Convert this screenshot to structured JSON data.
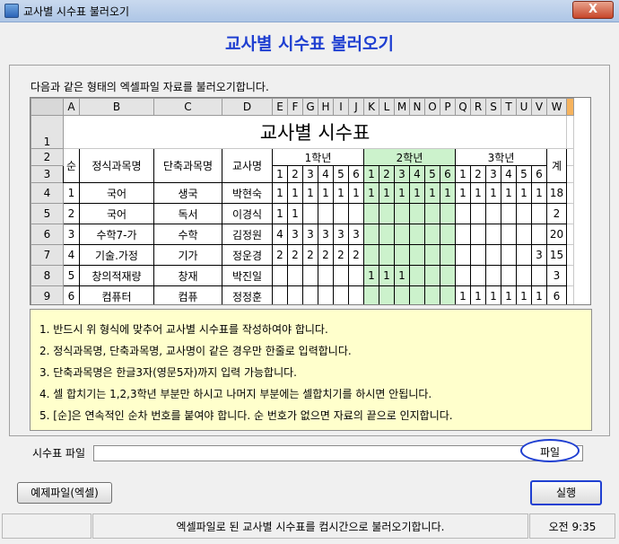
{
  "window": {
    "title": "교사별 시수표 불러오기",
    "close_label": "X"
  },
  "heading": "교사별 시수표 불러오기",
  "intro": "다음과 같은 형태의 엑셀파일 자료를 불러오기합니다.",
  "sheet": {
    "columns": [
      "A",
      "B",
      "C",
      "D",
      "E",
      "F",
      "G",
      "H",
      "I",
      "J",
      "K",
      "L",
      "M",
      "N",
      "O",
      "P",
      "Q",
      "R",
      "S",
      "T",
      "U",
      "V",
      "W"
    ],
    "row_numbers": [
      "1",
      "2",
      "3",
      "4",
      "5",
      "6",
      "7",
      "8",
      "9"
    ],
    "title": "교사별 시수표",
    "headers": {
      "no": "순",
      "full_name": "정식과목명",
      "short_name": "단축과목명",
      "teacher": "교사명",
      "total": "계"
    },
    "grades": [
      "1학년",
      "2학년",
      "3학년"
    ],
    "periods": [
      "1",
      "2",
      "3",
      "4",
      "5",
      "6"
    ],
    "rows": [
      {
        "no": "1",
        "full": "국어",
        "short": "생국",
        "teacher": "박현숙",
        "g": [
          "1",
          "1",
          "1",
          "1",
          "1",
          "1",
          "1",
          "1",
          "1",
          "1",
          "1",
          "1",
          "1",
          "1",
          "1",
          "1",
          "1",
          "1"
        ],
        "total": "18"
      },
      {
        "no": "2",
        "full": "국어",
        "short": "독서",
        "teacher": "이경식",
        "g": [
          "1",
          "1",
          "",
          "",
          "",
          "",
          "",
          "",
          "",
          "",
          "",
          "",
          "",
          "",
          "",
          "",
          "",
          ""
        ],
        "total": "2"
      },
      {
        "no": "3",
        "full": "수학7-가",
        "short": "수학",
        "teacher": "김정원",
        "g": [
          "4",
          "3",
          "3",
          "3",
          "3",
          "3",
          "",
          "",
          "",
          "",
          "",
          "",
          "",
          "",
          "",
          "",
          "",
          ""
        ],
        "total": "20"
      },
      {
        "no": "4",
        "full": "기술.가정",
        "short": "기가",
        "teacher": "정운경",
        "g": [
          "2",
          "2",
          "2",
          "2",
          "2",
          "2",
          "",
          "",
          "",
          "",
          "",
          "",
          "",
          "",
          "",
          "",
          "",
          "3"
        ],
        "total": "15"
      },
      {
        "no": "5",
        "full": "창의적재량",
        "short": "창재",
        "teacher": "박진일",
        "g": [
          "",
          "",
          "",
          "",
          "",
          "",
          "1",
          "1",
          "1",
          "",
          "",
          "",
          "",
          "",
          "",
          "",
          "",
          ""
        ],
        "total": "3"
      },
      {
        "no": "6",
        "full": "컴퓨터",
        "short": "컴퓨",
        "teacher": "정정훈",
        "g": [
          "",
          "",
          "",
          "",
          "",
          "",
          "",
          "",
          "",
          "",
          "",
          "",
          "1",
          "1",
          "1",
          "1",
          "1",
          "1"
        ],
        "total": "6"
      }
    ]
  },
  "notes": [
    "1. 반드시 위 형식에 맞추어 교사별 시수표를 작성하여야 합니다.",
    "2. 정식과목명, 단축과목명, 교사명이 같은 경우만 한줄로 입력합니다.",
    "3. 단축과목명은 한글3자(영문5자)까지 입력 가능합니다.",
    "4. 셀 합치기는 1,2,3학년 부분만 하시고 나머지 부분에는 셀합치기를 하시면 안됩니다.",
    "5. [순]은 연속적인 순차 번호를 붙여야 합니다. 순 번호가 없으면 자료의 끝으로 인지합니다."
  ],
  "file": {
    "label": "시수표 파일",
    "value": "",
    "button": "파일"
  },
  "buttons": {
    "sample": "예제파일(엑셀)",
    "run": "실행"
  },
  "status": {
    "message": "엑셀파일로 된 교사별 시수표를 컴시간으로 불러오기합니다.",
    "time": "오전 9:35"
  },
  "colors": {
    "heading": "#1f3fd1",
    "grade2_fill": "#ccf2cc",
    "notes_bg": "#ffffcc"
  }
}
